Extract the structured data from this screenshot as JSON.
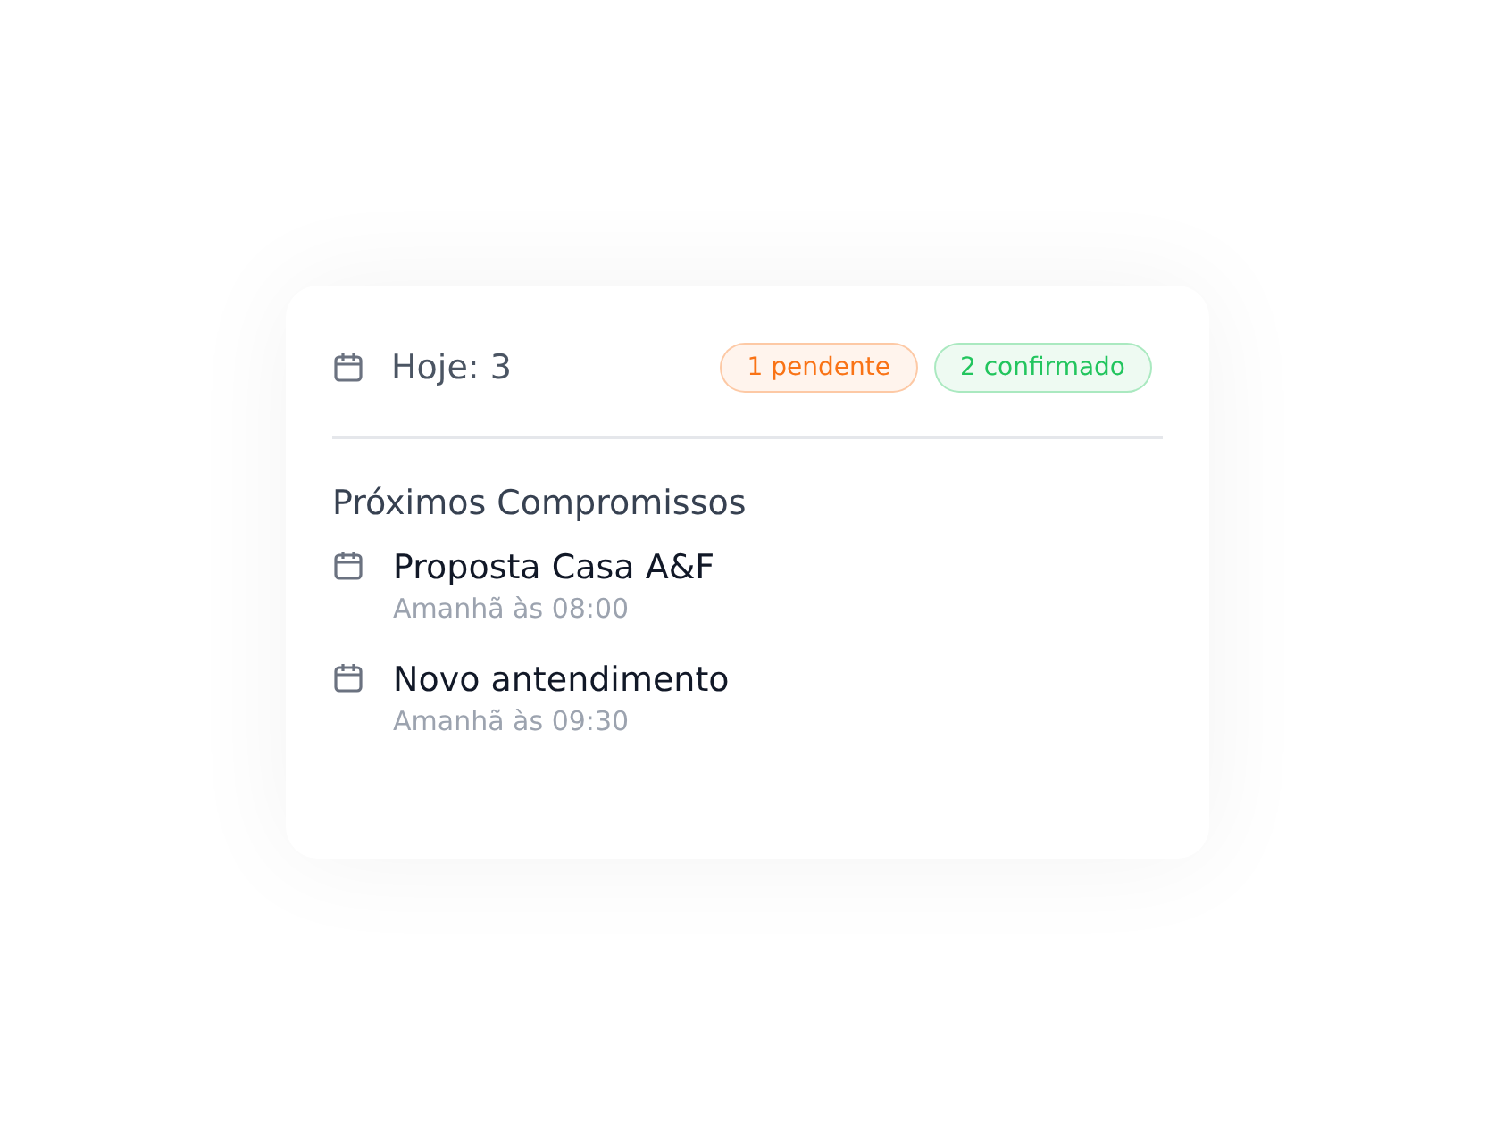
{
  "summary": {
    "label": "Hoje: 3",
    "badges": [
      {
        "text": "1 pendente",
        "color": "#f97316"
      },
      {
        "text": "2 confirmado",
        "color": "#22c55e"
      }
    ]
  },
  "upcoming": {
    "title": "Próximos Compromissos",
    "items": [
      {
        "title": "Proposta Casa A&F",
        "time": "Amanhã às 08:00"
      },
      {
        "title": "Novo antendimento",
        "time": "Amanhã às 09:30"
      }
    ]
  }
}
